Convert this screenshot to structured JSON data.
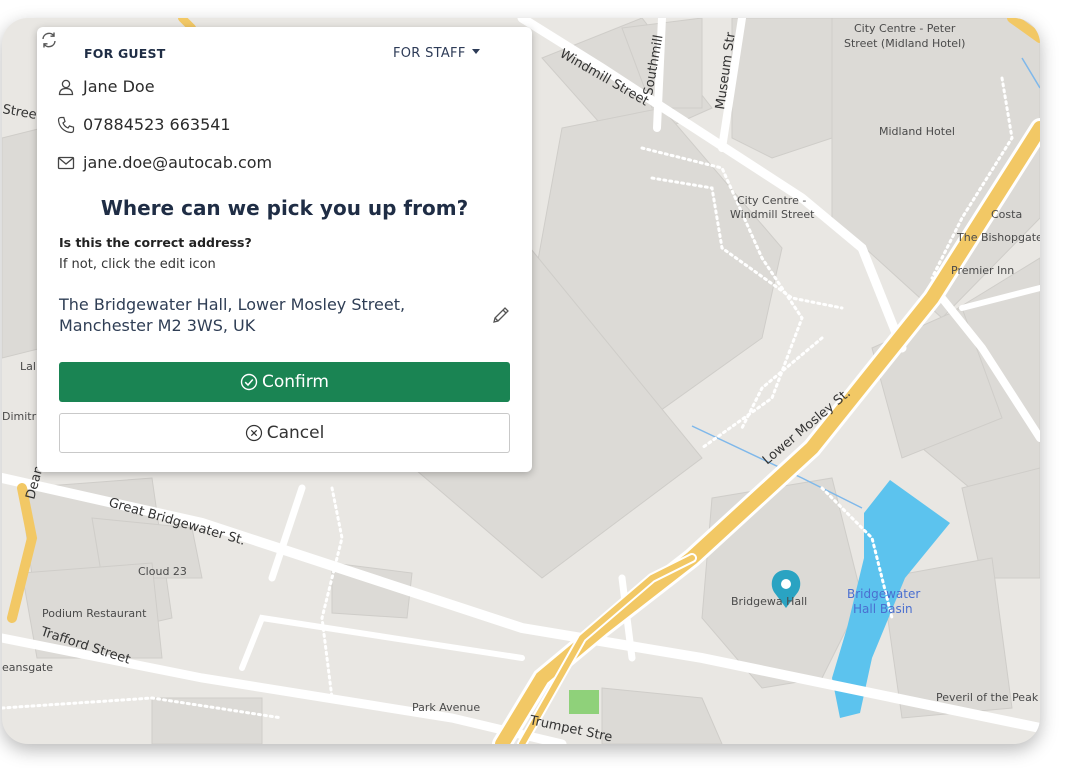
{
  "panel": {
    "tabs": {
      "guest": "FOR GUEST",
      "staff": "FOR STAFF"
    },
    "contact": {
      "name": "Jane Doe",
      "phone": "07884523 663541",
      "email": "jane.doe@autocab.com"
    },
    "heading": "Where can we pick you up from?",
    "question": "Is this the correct address?",
    "hint": "If not, click the edit icon",
    "address_line1": "The Bridgewater Hall, Lower Mosley Street,",
    "address_line2": "Manchester M2 3WS, UK",
    "confirm_label": "Confirm",
    "cancel_label": "Cancel",
    "icons": [
      "refresh-icon",
      "user-icon",
      "phone-icon",
      "email-icon",
      "edit-icon",
      "check-circle-icon",
      "cancel-circle-icon"
    ]
  },
  "map": {
    "labels": {
      "windmill_street": "Windmill Street",
      "southmill": "Southmill",
      "museum_st": "Museum Str",
      "city_centre_peter": "City Centre - Peter",
      "street_midland": "Street (Midland Hotel)",
      "midland_hotel": "Midland Hotel",
      "city_centre_windmill": "City Centre -",
      "windmill_street2": "Windmill Street",
      "costa": "Costa",
      "bishopgate": "The Bishopgate",
      "premier_inn": "Premier Inn",
      "lower_mosley": "Lower Mosley St.",
      "great_bridgewater": "Great Bridgewater St.",
      "cloud23": "Cloud 23",
      "podium": "Podium Restaurant",
      "trafford": "Trafford Street",
      "deansgate": "eansgate",
      "park_avenue": "Park Avenue",
      "trumpet": "Trumpet Stre",
      "bridgewater_hall": "Bridgewa Hall",
      "basin1": "Bridgewater",
      "basin2": "Hall Basin",
      "peveril": "Peveril of the Peak",
      "street_left": "Street",
      "lal": "Lal",
      "dimitri": "Dimitri'",
      "dean": "Dean"
    },
    "colors": {
      "land": "#e9e7e3",
      "building": "#dcdad6",
      "road": "#ffffff",
      "major_road": "#f2c865",
      "water": "#5cc3ee",
      "marker": "#2aa3c2",
      "park": "#8fd17a"
    }
  },
  "theme": {
    "confirm_color": "#1a8453",
    "heading_color": "#1f2d45"
  }
}
